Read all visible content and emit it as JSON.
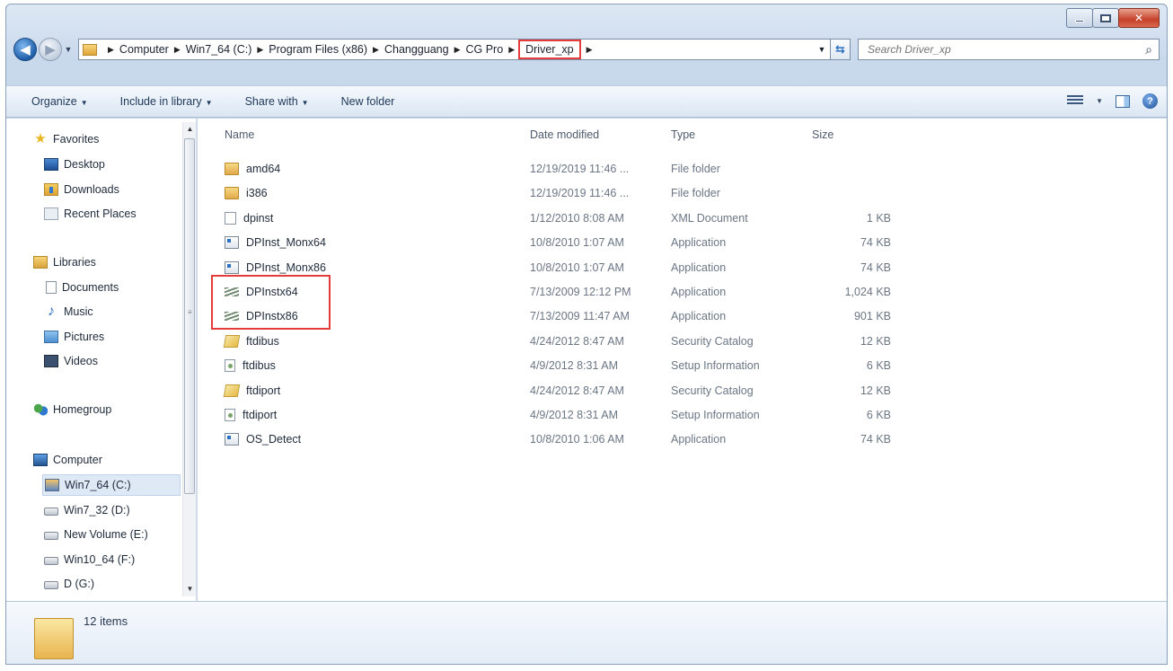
{
  "window": {
    "caption_buttons": {
      "minimize": "minimize",
      "maximize": "maximize",
      "close": "close"
    }
  },
  "address_bar": {
    "breadcrumbs": [
      "Computer",
      "Win7_64 (C:)",
      "Program Files (x86)",
      "Changguang",
      "CG Pro",
      "Driver_xp"
    ]
  },
  "search": {
    "placeholder": "Search Driver_xp"
  },
  "toolbar": {
    "organize": "Organize",
    "include_in_library": "Include in library",
    "share_with": "Share with",
    "new_folder": "New folder"
  },
  "nav_pane": {
    "favorites": "Favorites",
    "desktop": "Desktop",
    "downloads": "Downloads",
    "recent_places": "Recent Places",
    "libraries": "Libraries",
    "documents": "Documents",
    "music": "Music",
    "pictures": "Pictures",
    "videos": "Videos",
    "homegroup": "Homegroup",
    "computer": "Computer",
    "drives": [
      "Win7_64 (C:)",
      "Win7_32 (D:)",
      "New Volume (E:)",
      "Win10_64 (F:)",
      "D (G:)"
    ]
  },
  "columns": {
    "name": "Name",
    "date_modified": "Date modified",
    "type": "Type",
    "size": "Size"
  },
  "files": [
    {
      "name": "amd64",
      "date": "12/19/2019 11:46 ...",
      "type": "File folder",
      "size": "",
      "icon": "folder-icon"
    },
    {
      "name": "i386",
      "date": "12/19/2019 11:46 ...",
      "type": "File folder",
      "size": "",
      "icon": "folder-icon"
    },
    {
      "name": "dpinst",
      "date": "1/12/2010 8:08 AM",
      "type": "XML Document",
      "size": "1 KB",
      "icon": "xml-file-icon"
    },
    {
      "name": "DPInst_Monx64",
      "date": "10/8/2010 1:07 AM",
      "type": "Application",
      "size": "74 KB",
      "icon": "application-icon"
    },
    {
      "name": "DPInst_Monx86",
      "date": "10/8/2010 1:07 AM",
      "type": "Application",
      "size": "74 KB",
      "icon": "application-icon"
    },
    {
      "name": "DPInstx64",
      "date": "7/13/2009 12:12 PM",
      "type": "Application",
      "size": "1,024 KB",
      "icon": "installer-icon"
    },
    {
      "name": "DPInstx86",
      "date": "7/13/2009 11:47 AM",
      "type": "Application",
      "size": "901 KB",
      "icon": "installer-icon"
    },
    {
      "name": "ftdibus",
      "date": "4/24/2012 8:47 AM",
      "type": "Security Catalog",
      "size": "12 KB",
      "icon": "security-catalog-icon"
    },
    {
      "name": "ftdibus",
      "date": "4/9/2012 8:31 AM",
      "type": "Setup Information",
      "size": "6 KB",
      "icon": "setup-info-icon"
    },
    {
      "name": "ftdiport",
      "date": "4/24/2012 8:47 AM",
      "type": "Security Catalog",
      "size": "12 KB",
      "icon": "security-catalog-icon"
    },
    {
      "name": "ftdiport",
      "date": "4/9/2012 8:31 AM",
      "type": "Setup Information",
      "size": "6 KB",
      "icon": "setup-info-icon"
    },
    {
      "name": "OS_Detect",
      "date": "10/8/2010 1:06 AM",
      "type": "Application",
      "size": "74 KB",
      "icon": "application-icon"
    }
  ],
  "status": {
    "item_count": "12 items"
  },
  "highlight_color": "#e63b3b"
}
